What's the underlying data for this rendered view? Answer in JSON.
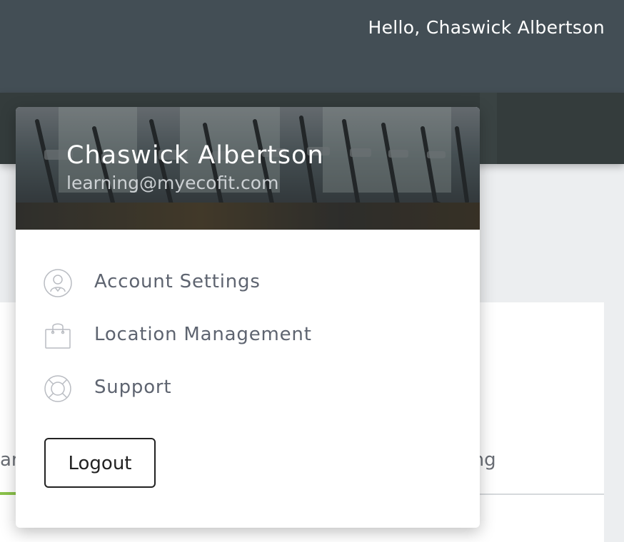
{
  "header": {
    "greeting": "Hello, Chaswick Albertson"
  },
  "background_tabs": {
    "left_partial": "ar",
    "right_partial": "lling",
    "active_color": "#8bc34a"
  },
  "dropdown": {
    "user_name": "Chaswick Albertson",
    "user_email": "learning@myecofit.com",
    "items": [
      {
        "label": "Account Settings",
        "icon": "user-avatar-icon"
      },
      {
        "label": "Location Management",
        "icon": "shopping-bag-icon"
      },
      {
        "label": "Support",
        "icon": "lifebuoy-icon"
      }
    ],
    "logout_label": "Logout"
  },
  "colors": {
    "topbar": "#434e55",
    "subnav": "#343c3c",
    "menu_text": "#5e6470"
  }
}
